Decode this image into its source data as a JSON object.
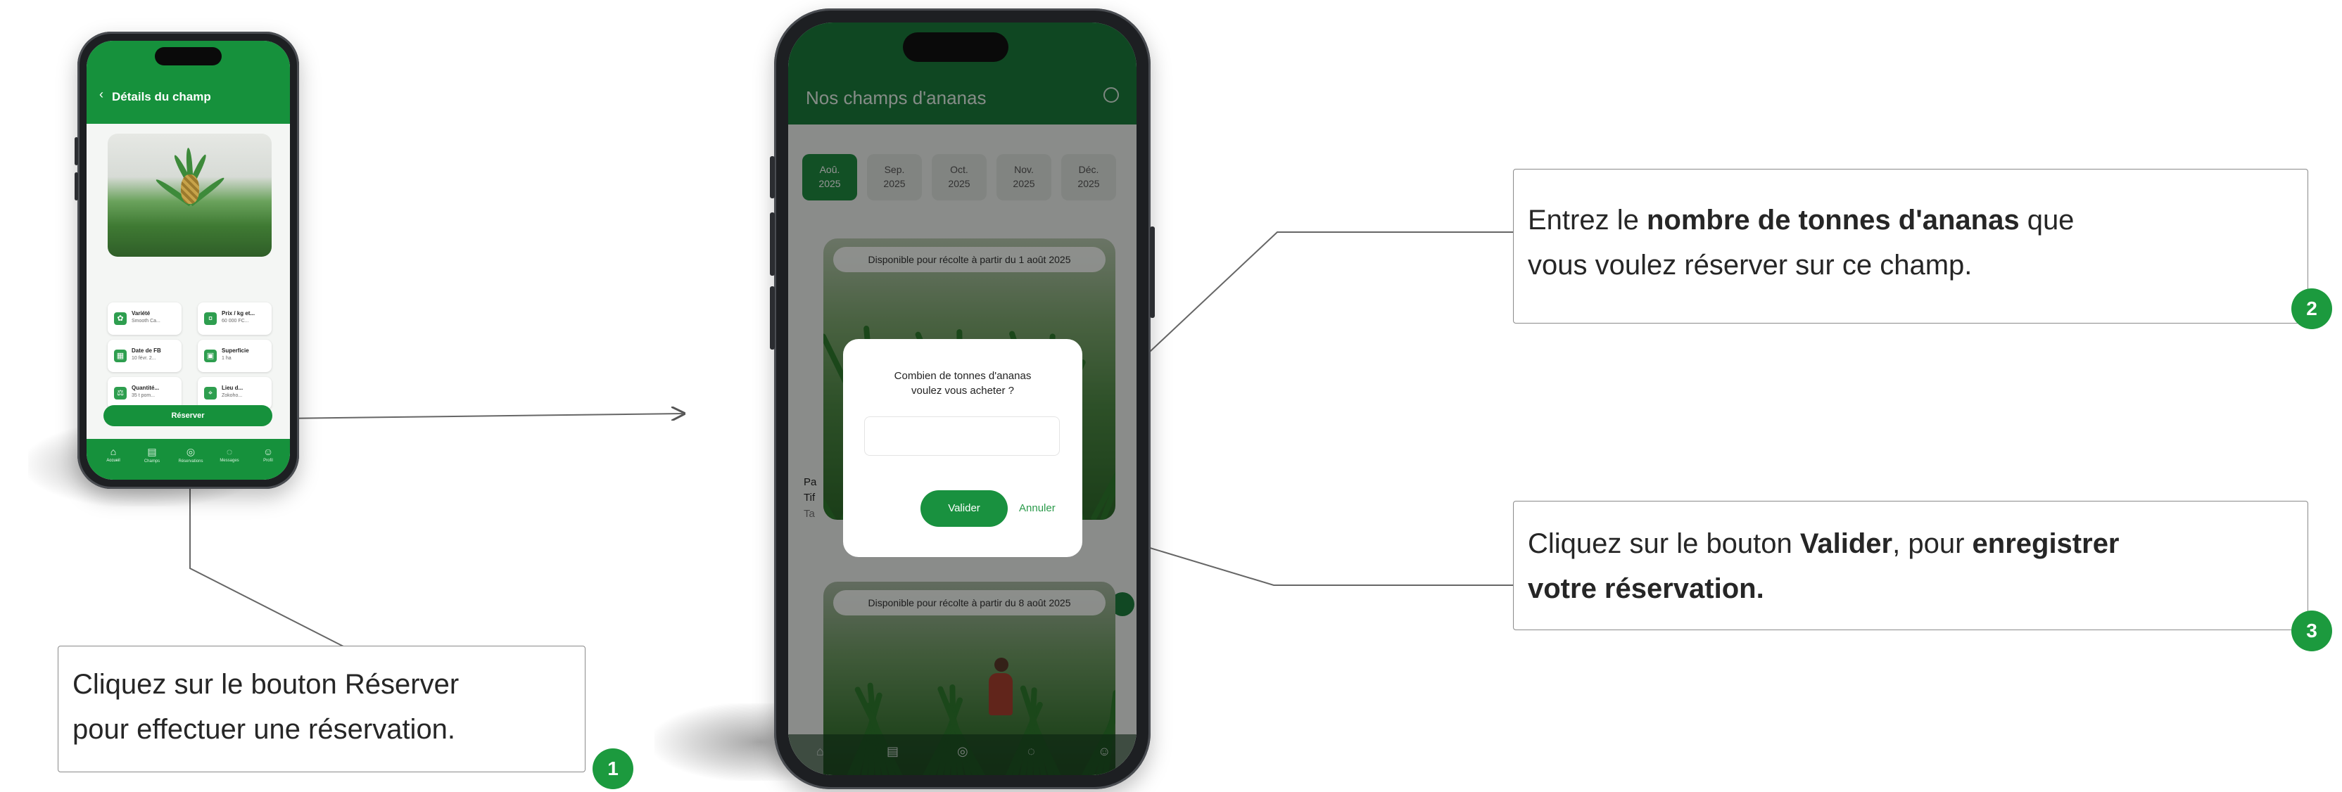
{
  "small_phone": {
    "header_title": "Détails du champ",
    "info_cards": [
      {
        "icon": "leaf-icon",
        "glyph": "✿",
        "title": "Variété",
        "value": "Smooth Ca..."
      },
      {
        "icon": "price-icon",
        "glyph": "¤",
        "title": "Prix / kg et...",
        "value": "60 000 FC..."
      },
      {
        "icon": "calendar-icon",
        "glyph": "▦",
        "title": "Date de FB",
        "value": "10 févr. 2..."
      },
      {
        "icon": "area-icon",
        "glyph": "▣",
        "title": "Superficie",
        "value": "1 ha"
      },
      {
        "icon": "weight-icon",
        "glyph": "⚖",
        "title": "Quantité...",
        "value": "35 t pom..."
      },
      {
        "icon": "location-icon",
        "glyph": "⌖",
        "title": "Lieu d...",
        "value": "Zokoho..."
      }
    ],
    "reserve_button": "Réserver",
    "nav": [
      {
        "icon": "home-icon",
        "glyph": "⌂",
        "label": "Accueil"
      },
      {
        "icon": "fields-icon",
        "glyph": "▤",
        "label": "Champs"
      },
      {
        "icon": "orders-icon",
        "glyph": "◎",
        "label": "Réservations"
      },
      {
        "icon": "chat-icon",
        "glyph": "◌",
        "label": "Messages"
      },
      {
        "icon": "profile-icon",
        "glyph": "☺",
        "label": "Profil"
      }
    ]
  },
  "big_phone": {
    "header_title": "Nos champs d'ananas",
    "months": [
      {
        "month": "Aoû.",
        "year": "2025",
        "active": true
      },
      {
        "month": "Sep.",
        "year": "2025",
        "active": false
      },
      {
        "month": "Oct.",
        "year": "2025",
        "active": false
      },
      {
        "month": "Nov.",
        "year": "2025",
        "active": false
      },
      {
        "month": "Déc.",
        "year": "2025",
        "active": false
      }
    ],
    "card1_banner": "Disponible pour récolte à partir du 1 août 2025",
    "card2_banner": "Disponible pour récolte à partir du 8 août 2025",
    "partial_texts": [
      "Pa",
      "Tif",
      "Ta"
    ],
    "dialog": {
      "question_line1": "Combien de tonnes d'ananas",
      "question_line2": "voulez vous acheter ?",
      "input_value": "",
      "confirm_button": "Valider",
      "cancel_button": "Annuler"
    }
  },
  "callouts": {
    "step1": {
      "number": "1",
      "line1_prefix": "Cliquez sur le bouton ",
      "line1_bold": "Réserver",
      "line2": "pour effectuer une réservation."
    },
    "step2": {
      "number": "2",
      "line1_prefix": "Entrez le ",
      "line1_bold": "nombre de tonnes d'ananas",
      "line1_suffix": " que",
      "line2": "vous voulez réserver sur ce champ."
    },
    "step3": {
      "number": "3",
      "line1_prefix": "Cliquez sur le bouton ",
      "line1_bold": "Valider",
      "line1_mid": ", pour ",
      "line1_bold2": "enregistrer",
      "line2_bold": "votre réservation."
    }
  },
  "colors": {
    "brand_green": "#16913c",
    "badge_green": "#1c9a3e"
  }
}
